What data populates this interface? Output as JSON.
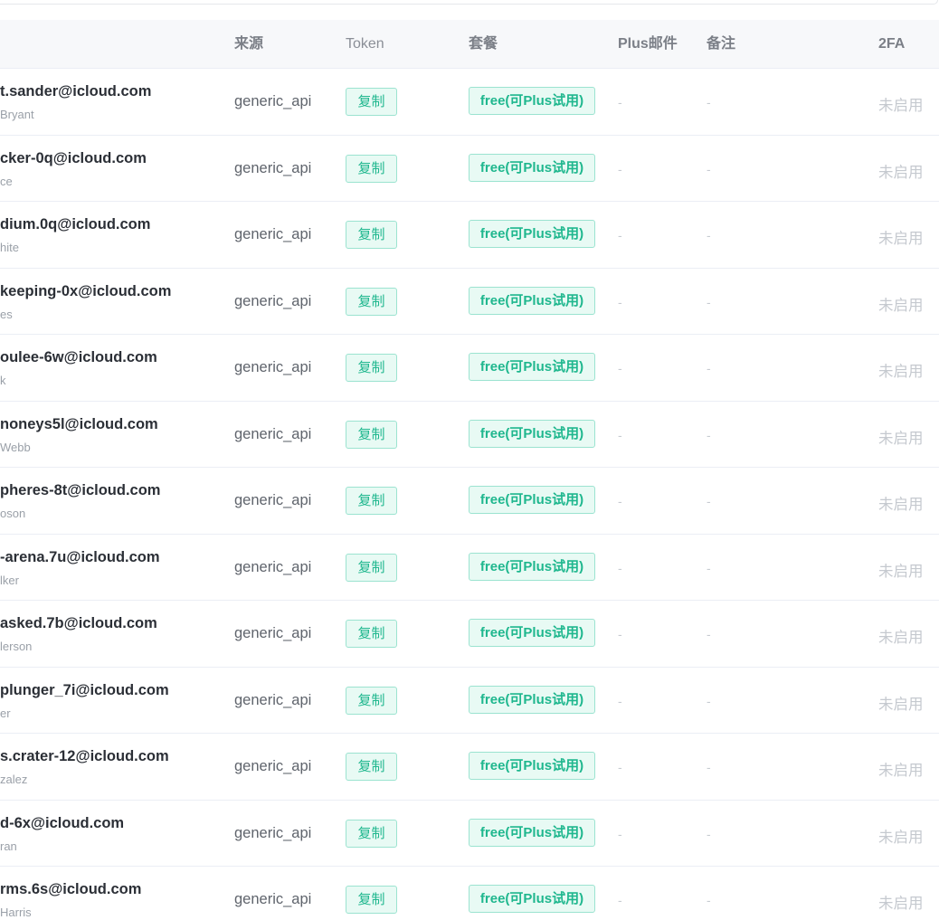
{
  "headers": {
    "source": "来源",
    "token": "Token",
    "plan": "套餐",
    "plus_email": "Plus邮件",
    "note": "备注",
    "twofa": "2FA"
  },
  "rows": [
    {
      "email": "t.sander@icloud.com",
      "name": "Bryant",
      "source": "generic_api",
      "token": "复制",
      "plan": "free(可Plus试用)",
      "plus_email": "-",
      "note": "-",
      "twofa": "未启用"
    },
    {
      "email": "cker-0q@icloud.com",
      "name": "ce",
      "source": "generic_api",
      "token": "复制",
      "plan": "free(可Plus试用)",
      "plus_email": "-",
      "note": "-",
      "twofa": "未启用"
    },
    {
      "email": "dium.0q@icloud.com",
      "name": "hite",
      "source": "generic_api",
      "token": "复制",
      "plan": "free(可Plus试用)",
      "plus_email": "-",
      "note": "-",
      "twofa": "未启用"
    },
    {
      "email": "keeping-0x@icloud.com",
      "name": "es",
      "source": "generic_api",
      "token": "复制",
      "plan": "free(可Plus试用)",
      "plus_email": "-",
      "note": "-",
      "twofa": "未启用"
    },
    {
      "email": "oulee-6w@icloud.com",
      "name": "k",
      "source": "generic_api",
      "token": "复制",
      "plan": "free(可Plus试用)",
      "plus_email": "-",
      "note": "-",
      "twofa": "未启用"
    },
    {
      "email": "noneys5l@icloud.com",
      "name": "Webb",
      "source": "generic_api",
      "token": "复制",
      "plan": "free(可Plus试用)",
      "plus_email": "-",
      "note": "-",
      "twofa": "未启用"
    },
    {
      "email": "pheres-8t@icloud.com",
      "name": "oson",
      "source": "generic_api",
      "token": "复制",
      "plan": "free(可Plus试用)",
      "plus_email": "-",
      "note": "-",
      "twofa": "未启用"
    },
    {
      "email": "-arena.7u@icloud.com",
      "name": "lker",
      "source": "generic_api",
      "token": "复制",
      "plan": "free(可Plus试用)",
      "plus_email": "-",
      "note": "-",
      "twofa": "未启用"
    },
    {
      "email": "asked.7b@icloud.com",
      "name": "lerson",
      "source": "generic_api",
      "token": "复制",
      "plan": "free(可Plus试用)",
      "plus_email": "-",
      "note": "-",
      "twofa": "未启用"
    },
    {
      "email": "plunger_7i@icloud.com",
      "name": "er",
      "source": "generic_api",
      "token": "复制",
      "plan": "free(可Plus试用)",
      "plus_email": "-",
      "note": "-",
      "twofa": "未启用"
    },
    {
      "email": "s.crater-12@icloud.com",
      "name": "zalez",
      "source": "generic_api",
      "token": "复制",
      "plan": "free(可Plus试用)",
      "plus_email": "-",
      "note": "-",
      "twofa": "未启用"
    },
    {
      "email": "d-6x@icloud.com",
      "name": "ran",
      "source": "generic_api",
      "token": "复制",
      "plan": "free(可Plus试用)",
      "plus_email": "-",
      "note": "-",
      "twofa": "未启用"
    },
    {
      "email": "rms.6s@icloud.com",
      "name": "Harris",
      "source": "generic_api",
      "token": "复制",
      "plan": "free(可Plus试用)",
      "plus_email": "-",
      "note": "-",
      "twofa": "未启用"
    }
  ],
  "colors": {
    "accent": "#1fb78e",
    "tag_bg": "#e8faf4",
    "tag_border": "#9be3d0",
    "header_bg": "#f7f8fa"
  }
}
